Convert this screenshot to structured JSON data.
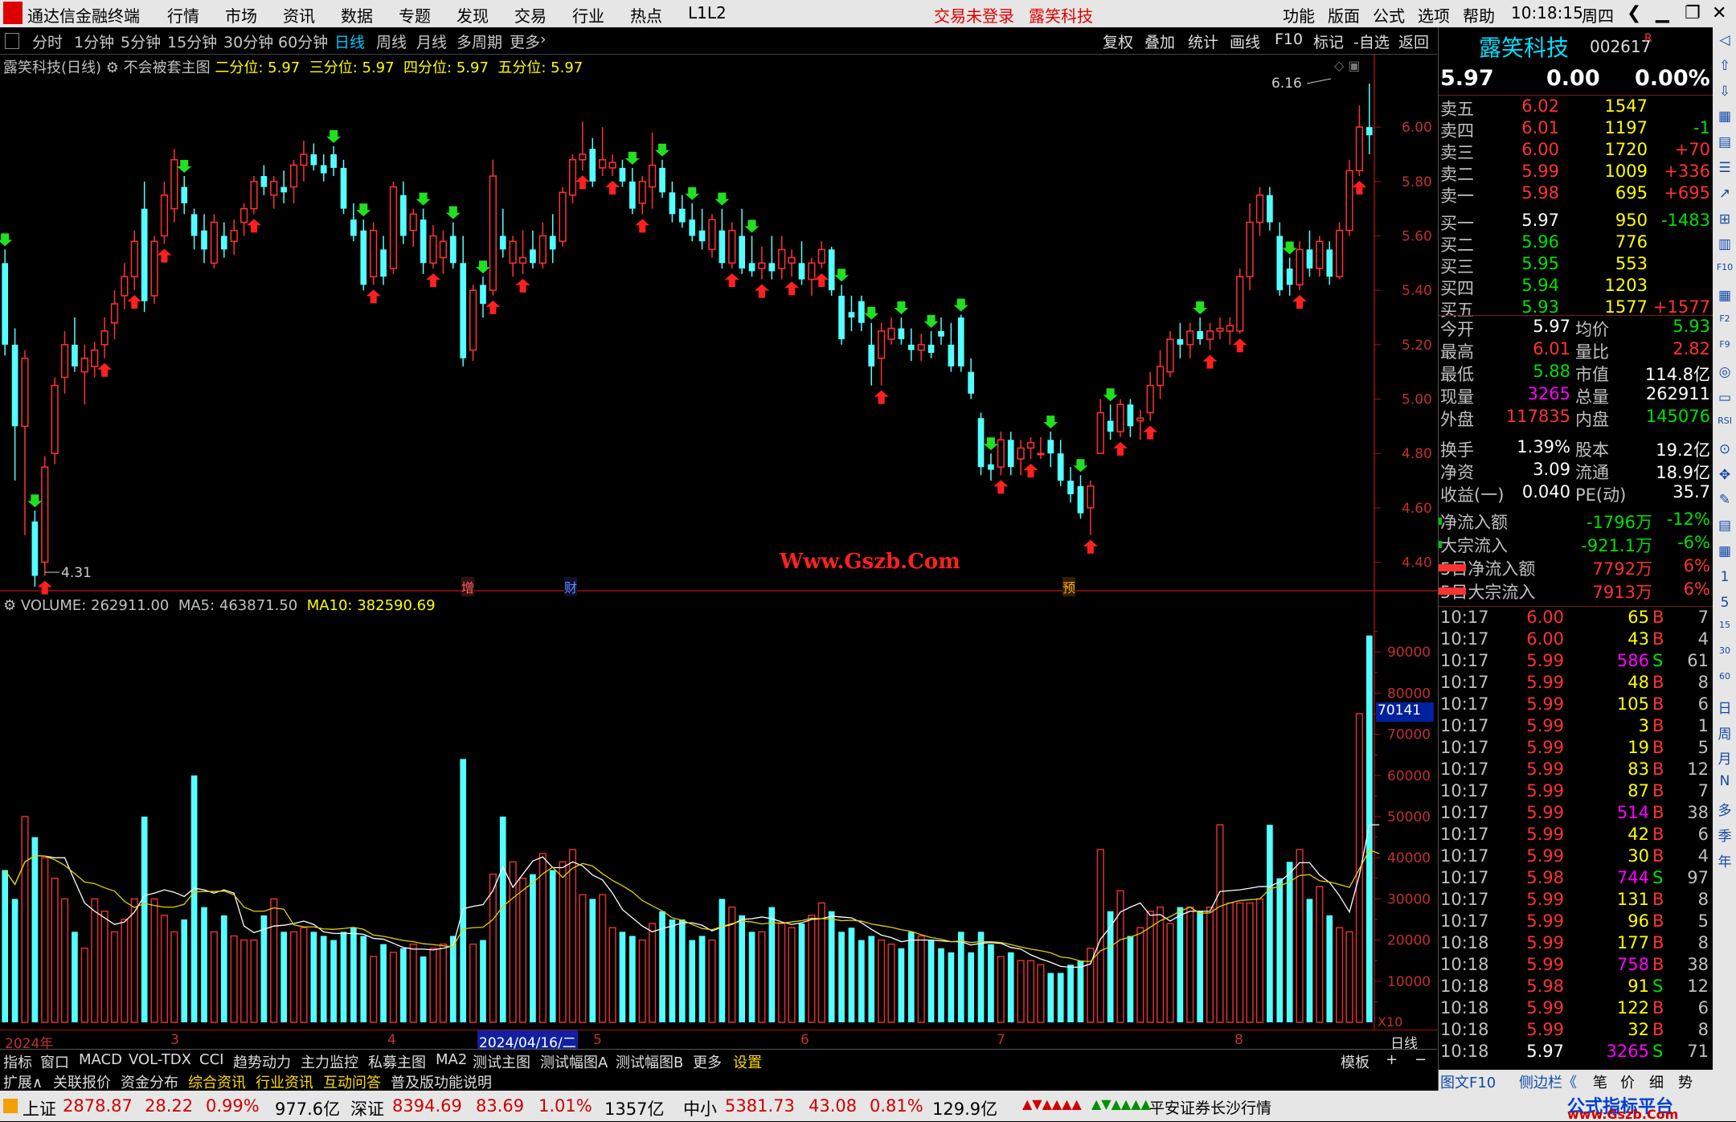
{
  "app": {
    "title": "通达信金融终端",
    "menu": [
      "行情",
      "市场",
      "资讯",
      "数据",
      "专题",
      "发现",
      "交易",
      "行业",
      "热点",
      "L1L2"
    ],
    "login_status": "交易未登录",
    "stock_title": "露笑科技",
    "right_menu": [
      "功能",
      "版面",
      "公式",
      "选项",
      "帮助"
    ],
    "time": "10:18:15",
    "weekday": "周四"
  },
  "toolbar": {
    "periods": [
      "分时",
      "1分钟",
      "5分钟",
      "15分钟",
      "30分钟",
      "60分钟",
      "日线",
      "周线",
      "月线",
      "多周期",
      "更多"
    ],
    "selected": "日线",
    "actions": [
      "复权",
      "叠加",
      "统计",
      "画线",
      "F10",
      "标记",
      "-自选",
      "返回"
    ]
  },
  "chart_info": {
    "name": "露笑科技(日线)",
    "mode": "不会被套主图",
    "level2": "二分位: 5.97",
    "level3": "三分位: 5.97",
    "level4": "四分位: 5.97",
    "level5": "五分位: 5.97",
    "high_label": "6.16",
    "low_label": "4.31",
    "markers": [
      "增",
      "财",
      "预"
    ],
    "watermark": "Www.Gszb.Com",
    "volume_info": "VOLUME: 262911.00",
    "ma5": "MA5: 463871.50",
    "ma10": "MA10: 382590.69",
    "volume_cursor": "70141",
    "x10": "X10"
  },
  "price_axis": [
    "6.00",
    "5.80",
    "5.60",
    "5.40",
    "5.20",
    "5.00",
    "4.80",
    "4.60",
    "4.40"
  ],
  "volume_axis": [
    "90000",
    "80000",
    "70000",
    "60000",
    "50000",
    "40000",
    "30000",
    "20000",
    "10000"
  ],
  "date_axis": {
    "labels": [
      "2024年",
      "3",
      "4",
      "2024/04/16/二",
      "5",
      "6",
      "7",
      "8"
    ],
    "period": "日线"
  },
  "indicator_tabs": [
    "指标",
    "窗口",
    "MACD",
    "VOL-TDX",
    "CCI",
    "趋势动力",
    "主力监控",
    "私募主图",
    "MA2",
    "测试主图",
    "测试幅图A",
    "测试幅图B",
    "更多",
    "设置"
  ],
  "template_btn": "模板",
  "info_tabs": [
    "扩展∧",
    "关联报价",
    "资金分布",
    "综合资讯",
    "行业资讯",
    "互动问答",
    "普及版功能说明"
  ],
  "quote": {
    "name": "露笑科技",
    "code": "002617",
    "flag": "R",
    "price": "5.97",
    "change": "0.00",
    "pct": "0.00%",
    "sells": [
      {
        "l": "卖五",
        "p": "6.02",
        "v": "1547",
        "d": ""
      },
      {
        "l": "卖四",
        "p": "6.01",
        "v": "1197",
        "d": "-1"
      },
      {
        "l": "卖三",
        "p": "6.00",
        "v": "1720",
        "d": "+70"
      },
      {
        "l": "卖二",
        "p": "5.99",
        "v": "1009",
        "d": "+336"
      },
      {
        "l": "卖一",
        "p": "5.98",
        "v": "695",
        "d": "+695"
      }
    ],
    "buys": [
      {
        "l": "买一",
        "p": "5.97",
        "v": "950",
        "d": "-1483"
      },
      {
        "l": "买二",
        "p": "5.96",
        "v": "776",
        "d": ""
      },
      {
        "l": "买三",
        "p": "5.95",
        "v": "553",
        "d": ""
      },
      {
        "l": "买四",
        "p": "5.94",
        "v": "1203",
        "d": ""
      },
      {
        "l": "买五",
        "p": "5.93",
        "v": "1577",
        "d": "+1577"
      }
    ],
    "stats": [
      [
        "今开",
        "5.97",
        "均价",
        "5.93"
      ],
      [
        "最高",
        "6.01",
        "量比",
        "2.82"
      ],
      [
        "最低",
        "5.88",
        "市值",
        "114.8亿"
      ],
      [
        "现量",
        "3265",
        "总量",
        "262911"
      ],
      [
        "外盘",
        "117835",
        "内盘",
        "145076"
      ],
      [
        "换手",
        "1.39%",
        "股本",
        "19.2亿"
      ],
      [
        "净资",
        "3.09",
        "流通",
        "18.9亿"
      ],
      [
        "收益(一)",
        "0.040",
        "PE(动)",
        "35.7"
      ]
    ],
    "flows": [
      [
        "净流入额",
        "-1796万",
        "-12%"
      ],
      [
        "大宗流入",
        "-921.1万",
        "-6%"
      ],
      [
        "5日净流入额",
        "7792万",
        "6%"
      ],
      [
        "5日大宗流入",
        "7913万",
        "6%"
      ]
    ]
  },
  "ticks": [
    [
      "10:17",
      "6.00",
      "65",
      "B",
      "7"
    ],
    [
      "10:17",
      "6.00",
      "43",
      "B",
      "4"
    ],
    [
      "10:17",
      "5.99",
      "586",
      "S",
      "61"
    ],
    [
      "10:17",
      "5.99",
      "48",
      "B",
      "8"
    ],
    [
      "10:17",
      "5.99",
      "105",
      "B",
      "6"
    ],
    [
      "10:17",
      "5.99",
      "3",
      "B",
      "1"
    ],
    [
      "10:17",
      "5.99",
      "19",
      "B",
      "5"
    ],
    [
      "10:17",
      "5.99",
      "83",
      "B",
      "12"
    ],
    [
      "10:17",
      "5.99",
      "87",
      "B",
      "7"
    ],
    [
      "10:17",
      "5.99",
      "514",
      "B",
      "38"
    ],
    [
      "10:17",
      "5.99",
      "42",
      "B",
      "6"
    ],
    [
      "10:17",
      "5.99",
      "30",
      "B",
      "4"
    ],
    [
      "10:17",
      "5.98",
      "744",
      "S",
      "97"
    ],
    [
      "10:17",
      "5.99",
      "131",
      "B",
      "8"
    ],
    [
      "10:17",
      "5.99",
      "96",
      "B",
      "5"
    ],
    [
      "10:18",
      "5.99",
      "177",
      "B",
      "8"
    ],
    [
      "10:18",
      "5.99",
      "758",
      "B",
      "38"
    ],
    [
      "10:18",
      "5.98",
      "91",
      "S",
      "12"
    ],
    [
      "10:18",
      "5.99",
      "122",
      "B",
      "6"
    ],
    [
      "10:18",
      "5.99",
      "32",
      "B",
      "8"
    ],
    [
      "10:18",
      "5.97",
      "3265",
      "S",
      "71"
    ]
  ],
  "right_bottom_tabs": [
    "图文F10",
    "侧边栏《",
    "笔",
    "价",
    "细",
    "势"
  ],
  "side_icons": [
    "◁",
    "⇧",
    "⇩",
    "▦",
    "▤",
    "☰",
    "↗",
    "⊞",
    "▥",
    "F10",
    "▦",
    "F2",
    "F9",
    "◎",
    "▭",
    "RSI",
    "⊙",
    "✥",
    "✎",
    "▤",
    "▦",
    "1",
    "5",
    "15",
    "30",
    "60",
    "日",
    "周",
    "月",
    "N",
    "多",
    "季",
    "年"
  ],
  "status": {
    "sh_label": "上证",
    "sh": "2878.87",
    "sh_ch": "28.22",
    "sh_pct": "0.99%",
    "sh_amt": "977.6亿",
    "sz_label": "深证",
    "sz": "8394.69",
    "sz_ch": "83.69",
    "sz_pct": "1.01%",
    "sz_amt": "1357亿",
    "zx_label": "中小",
    "zx": "5381.73",
    "zx_ch": "43.08",
    "zx_pct": "0.81%",
    "zx_amt": "129.9亿",
    "broker": "平安证券长沙行情",
    "brand": "公式指标平台",
    "brand_url": "www.Gszb.Com"
  },
  "chart_data": {
    "type": "candlestick",
    "price_ylim": [
      4.31,
      6.16
    ],
    "candles": [
      [
        5.5,
        5.55,
        5.16,
        5.2
      ],
      [
        5.2,
        5.26,
        4.7,
        4.9
      ],
      [
        4.9,
        5.18,
        4.5,
        5.15
      ],
      [
        4.55,
        4.59,
        4.31,
        4.35
      ],
      [
        4.4,
        4.79,
        4.35,
        4.75
      ],
      [
        4.8,
        5.08,
        4.76,
        5.05
      ],
      [
        5.08,
        5.25,
        5.02,
        5.2
      ],
      [
        5.2,
        5.3,
        5.1,
        5.12
      ],
      [
        5.1,
        5.2,
        4.98,
        5.15
      ],
      [
        5.12,
        5.21,
        5.08,
        5.18
      ],
      [
        5.2,
        5.3,
        5.15,
        5.25
      ],
      [
        5.28,
        5.4,
        5.22,
        5.35
      ],
      [
        5.38,
        5.5,
        5.33,
        5.45
      ],
      [
        5.45,
        5.62,
        5.4,
        5.58
      ],
      [
        5.7,
        5.8,
        5.32,
        5.36
      ],
      [
        5.38,
        5.6,
        5.35,
        5.58
      ],
      [
        5.6,
        5.8,
        5.57,
        5.75
      ],
      [
        5.7,
        5.92,
        5.65,
        5.88
      ],
      [
        5.78,
        5.82,
        5.68,
        5.72
      ],
      [
        5.68,
        5.7,
        5.55,
        5.6
      ],
      [
        5.62,
        5.68,
        5.5,
        5.55
      ],
      [
        5.5,
        5.68,
        5.48,
        5.65
      ],
      [
        5.6,
        5.65,
        5.52,
        5.55
      ],
      [
        5.58,
        5.66,
        5.53,
        5.62
      ],
      [
        5.65,
        5.72,
        5.6,
        5.7
      ],
      [
        5.7,
        5.82,
        5.68,
        5.8
      ],
      [
        5.82,
        5.86,
        5.75,
        5.78
      ],
      [
        5.75,
        5.82,
        5.7,
        5.8
      ],
      [
        5.78,
        5.84,
        5.72,
        5.76
      ],
      [
        5.78,
        5.88,
        5.72,
        5.86
      ],
      [
        5.86,
        5.95,
        5.8,
        5.9
      ],
      [
        5.9,
        5.94,
        5.84,
        5.86
      ],
      [
        5.86,
        5.9,
        5.8,
        5.83
      ],
      [
        5.9,
        5.93,
        5.82,
        5.85
      ],
      [
        5.85,
        5.88,
        5.68,
        5.7
      ],
      [
        5.66,
        5.72,
        5.58,
        5.6
      ],
      [
        5.62,
        5.66,
        5.4,
        5.42
      ],
      [
        5.45,
        5.65,
        5.42,
        5.62
      ],
      [
        5.55,
        5.6,
        5.42,
        5.45
      ],
      [
        5.48,
        5.8,
        5.46,
        5.78
      ],
      [
        5.75,
        5.8,
        5.57,
        5.6
      ],
      [
        5.62,
        5.7,
        5.56,
        5.68
      ],
      [
        5.66,
        5.7,
        5.46,
        5.5
      ],
      [
        5.5,
        5.64,
        5.48,
        5.6
      ],
      [
        5.52,
        5.62,
        5.46,
        5.58
      ],
      [
        5.6,
        5.65,
        5.48,
        5.5
      ],
      [
        5.5,
        5.6,
        5.12,
        5.15
      ],
      [
        5.18,
        5.42,
        5.14,
        5.4
      ],
      [
        5.42,
        5.45,
        5.3,
        5.35
      ],
      [
        5.4,
        5.88,
        5.38,
        5.82
      ],
      [
        5.6,
        5.7,
        5.52,
        5.55
      ],
      [
        5.5,
        5.6,
        5.45,
        5.58
      ],
      [
        5.5,
        5.62,
        5.46,
        5.52
      ],
      [
        5.55,
        5.62,
        5.48,
        5.5
      ],
      [
        5.5,
        5.65,
        5.48,
        5.6
      ],
      [
        5.6,
        5.68,
        5.5,
        5.55
      ],
      [
        5.58,
        5.78,
        5.56,
        5.76
      ],
      [
        5.75,
        5.9,
        5.72,
        5.88
      ],
      [
        5.88,
        6.02,
        5.84,
        5.9
      ],
      [
        5.92,
        5.96,
        5.78,
        5.8
      ],
      [
        5.85,
        6.0,
        5.82,
        5.88
      ],
      [
        5.85,
        5.9,
        5.82,
        5.87
      ],
      [
        5.85,
        5.88,
        5.78,
        5.8
      ],
      [
        5.8,
        5.85,
        5.68,
        5.7
      ],
      [
        5.72,
        5.82,
        5.68,
        5.8
      ],
      [
        5.78,
        5.98,
        5.7,
        5.86
      ],
      [
        5.85,
        5.88,
        5.74,
        5.76
      ],
      [
        5.76,
        5.8,
        5.65,
        5.68
      ],
      [
        5.7,
        5.75,
        5.63,
        5.65
      ],
      [
        5.66,
        5.72,
        5.58,
        5.6
      ],
      [
        5.62,
        5.7,
        5.55,
        5.58
      ],
      [
        5.55,
        5.68,
        5.52,
        5.66
      ],
      [
        5.62,
        5.7,
        5.48,
        5.5
      ],
      [
        5.5,
        5.65,
        5.48,
        5.62
      ],
      [
        5.6,
        5.7,
        5.46,
        5.48
      ],
      [
        5.5,
        5.6,
        5.45,
        5.47
      ],
      [
        5.48,
        5.56,
        5.44,
        5.5
      ],
      [
        5.5,
        5.6,
        5.44,
        5.47
      ],
      [
        5.48,
        5.6,
        5.44,
        5.55
      ],
      [
        5.5,
        5.55,
        5.45,
        5.52
      ],
      [
        5.5,
        5.58,
        5.42,
        5.44
      ],
      [
        5.44,
        5.52,
        5.38,
        5.5
      ],
      [
        5.5,
        5.58,
        5.48,
        5.55
      ],
      [
        5.55,
        5.56,
        5.38,
        5.4
      ],
      [
        5.38,
        5.42,
        5.2,
        5.22
      ],
      [
        5.32,
        5.38,
        5.25,
        5.3
      ],
      [
        5.36,
        5.38,
        5.25,
        5.28
      ],
      [
        5.2,
        5.28,
        5.05,
        5.12
      ],
      [
        5.15,
        5.28,
        5.05,
        5.25
      ],
      [
        5.22,
        5.3,
        5.2,
        5.26
      ],
      [
        5.26,
        5.3,
        5.2,
        5.22
      ],
      [
        5.2,
        5.26,
        5.14,
        5.18
      ],
      [
        5.18,
        5.24,
        5.14,
        5.2
      ],
      [
        5.2,
        5.25,
        5.15,
        5.17
      ],
      [
        5.25,
        5.3,
        5.2,
        5.23
      ],
      [
        5.2,
        5.28,
        5.1,
        5.12
      ],
      [
        5.3,
        5.31,
        5.1,
        5.12
      ],
      [
        5.1,
        5.15,
        5.0,
        5.02
      ],
      [
        4.93,
        4.95,
        4.72,
        4.75
      ],
      [
        4.76,
        4.8,
        4.7,
        4.74
      ],
      [
        4.75,
        4.88,
        4.72,
        4.85
      ],
      [
        4.85,
        4.88,
        4.72,
        4.75
      ],
      [
        4.78,
        4.85,
        4.72,
        4.82
      ],
      [
        4.82,
        4.86,
        4.78,
        4.84
      ],
      [
        4.8,
        4.86,
        4.78,
        4.8
      ],
      [
        4.85,
        4.88,
        4.75,
        4.8
      ],
      [
        4.8,
        4.85,
        4.68,
        4.7
      ],
      [
        4.7,
        4.75,
        4.62,
        4.65
      ],
      [
        4.68,
        4.72,
        4.56,
        4.58
      ],
      [
        4.6,
        4.7,
        4.5,
        4.68
      ],
      [
        4.8,
        5.0,
        4.8,
        4.95
      ],
      [
        4.92,
        4.98,
        4.85,
        4.88
      ],
      [
        4.88,
        5.0,
        4.86,
        4.98
      ],
      [
        4.98,
        5.0,
        4.86,
        4.9
      ],
      [
        4.92,
        4.96,
        4.85,
        4.93
      ],
      [
        4.95,
        5.1,
        4.92,
        5.05
      ],
      [
        5.05,
        5.18,
        5.0,
        5.12
      ],
      [
        5.1,
        5.25,
        5.08,
        5.22
      ],
      [
        5.22,
        5.28,
        5.15,
        5.2
      ],
      [
        5.2,
        5.28,
        5.15,
        5.25
      ],
      [
        5.25,
        5.3,
        5.2,
        5.22
      ],
      [
        5.22,
        5.28,
        5.18,
        5.25
      ],
      [
        5.25,
        5.3,
        5.22,
        5.26
      ],
      [
        5.25,
        5.3,
        5.2,
        5.27
      ],
      [
        5.25,
        5.48,
        5.24,
        5.45
      ],
      [
        5.45,
        5.72,
        5.4,
        5.65
      ],
      [
        5.65,
        5.78,
        5.6,
        5.75
      ],
      [
        5.75,
        5.78,
        5.62,
        5.65
      ],
      [
        5.6,
        5.65,
        5.38,
        5.4
      ],
      [
        5.48,
        5.52,
        5.38,
        5.42
      ],
      [
        5.42,
        5.58,
        5.4,
        5.55
      ],
      [
        5.55,
        5.62,
        5.45,
        5.48
      ],
      [
        5.48,
        5.6,
        5.45,
        5.58
      ],
      [
        5.55,
        5.58,
        5.42,
        5.45
      ],
      [
        5.45,
        5.65,
        5.44,
        5.62
      ],
      [
        5.62,
        5.88,
        5.6,
        5.84
      ],
      [
        5.84,
        6.08,
        5.82,
        6.0
      ],
      [
        6.0,
        6.16,
        5.9,
        5.97
      ]
    ],
    "volume_ylim": [
      0,
      100000
    ],
    "volumes": [
      37000,
      30000,
      50000,
      45000,
      40000,
      35000,
      30000,
      22000,
      18000,
      30000,
      27000,
      22000,
      25000,
      30000,
      50000,
      30000,
      26000,
      22000,
      25000,
      60000,
      28000,
      22000,
      26000,
      21000,
      20000,
      20000,
      26000,
      30000,
      22000,
      22000,
      23000,
      22000,
      21000,
      20000,
      22000,
      23000,
      21000,
      16000,
      19000,
      17000,
      18000,
      19000,
      16000,
      18000,
      19000,
      21000,
      64000,
      19000,
      20000,
      36000,
      50000,
      39000,
      35000,
      36000,
      41000,
      37000,
      39000,
      42000,
      31000,
      30000,
      31000,
      23000,
      22000,
      21000,
      20000,
      24000,
      27000,
      25000,
      25000,
      20000,
      21000,
      20000,
      30000,
      28000,
      26000,
      22000,
      22000,
      28000,
      24000,
      23000,
      24000,
      26000,
      29000,
      27000,
      22000,
      23000,
      20000,
      21000,
      20000,
      19000,
      18000,
      22000,
      21000,
      20000,
      18000,
      17000,
      22000,
      17000,
      22000,
      19000,
      16000,
      17000,
      15000,
      15000,
      14000,
      12000,
      12000,
      14000,
      15000,
      18000,
      42000,
      27000,
      32000,
      21000,
      23000,
      27000,
      28000,
      24000,
      28000,
      28000,
      27000,
      28000,
      48000,
      29000,
      29000,
      29000,
      30000,
      48000,
      35000,
      39000,
      42000,
      30000,
      33000,
      26000,
      23000,
      22000,
      75000,
      94000,
      26000
    ]
  }
}
